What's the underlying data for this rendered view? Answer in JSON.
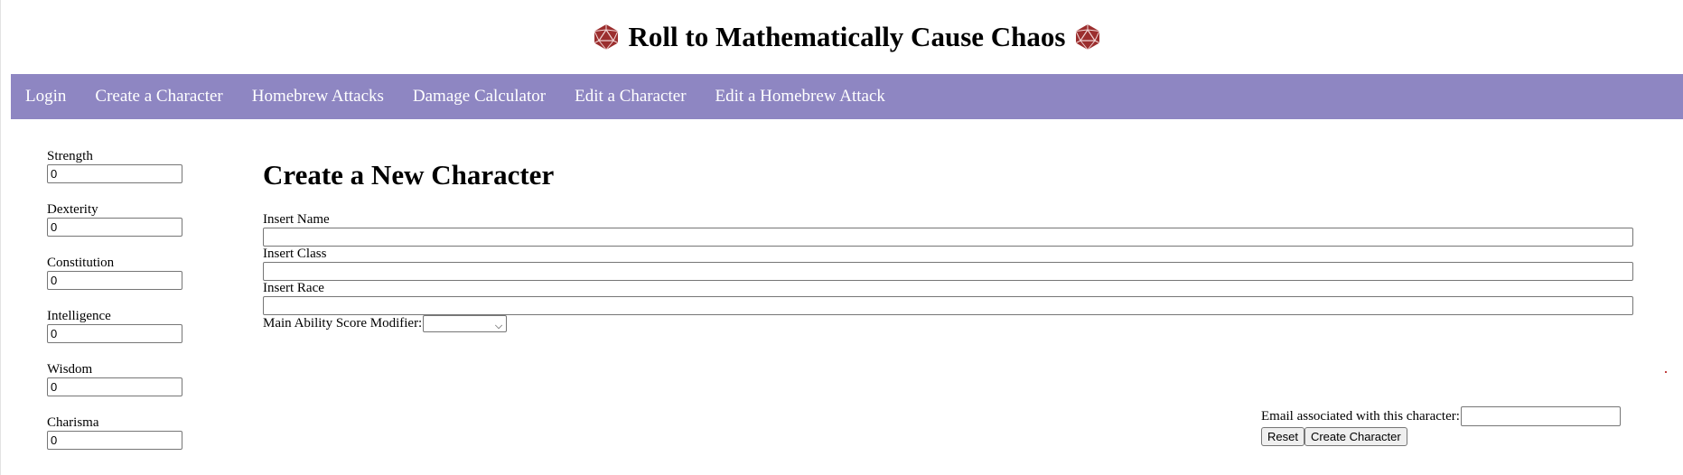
{
  "header": {
    "title": "Roll to Mathematically Cause Chaos",
    "icon_left": "d20-die-icon",
    "icon_right": "d20-die-icon",
    "icon_color": "#9b2e2e"
  },
  "nav": {
    "background": "#8e86c2",
    "items": [
      {
        "label": "Login"
      },
      {
        "label": "Create a Character"
      },
      {
        "label": "Homebrew Attacks"
      },
      {
        "label": "Damage Calculator"
      },
      {
        "label": "Edit a Character"
      },
      {
        "label": "Edit a Homebrew Attack"
      }
    ]
  },
  "stats": [
    {
      "label": "Strength",
      "value": "0"
    },
    {
      "label": "Dexterity",
      "value": "0"
    },
    {
      "label": "Constitution",
      "value": "0"
    },
    {
      "label": "Intelligence",
      "value": "0"
    },
    {
      "label": "Wisdom",
      "value": "0"
    },
    {
      "label": "Charisma",
      "value": "0"
    }
  ],
  "form": {
    "title": "Create a New Character",
    "name_label": "Insert Name",
    "name_value": "",
    "class_label": "Insert Class",
    "class_value": "",
    "race_label": "Insert Race",
    "race_value": "",
    "modifier_label": "Main Ability Score Modifier:",
    "modifier_selected": ""
  },
  "footer": {
    "email_label": "Email associated with this character:",
    "email_value": "",
    "reset_label": "Reset",
    "create_label": "Create Character"
  }
}
